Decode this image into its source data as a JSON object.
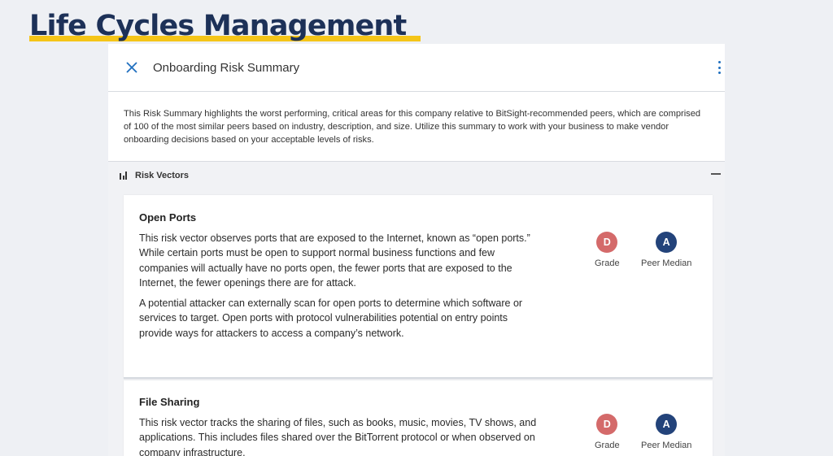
{
  "slide": {
    "title": "Life Cycles Management"
  },
  "panel": {
    "title": "Onboarding Risk Summary",
    "intro": "This Risk Summary highlights the worst performing, critical areas for this company relative to BitSight-recommended peers, which are comprised of 100 of the most similar peers based on industry, description, and size. Utilize this summary to work with your business to make vendor onboarding decisions based on your acceptable levels of risks.",
    "section_label": "Risk Vectors",
    "icons": {
      "close": "close-icon",
      "menu": "kebab-menu-icon",
      "section": "bar-chart-icon",
      "collapse": "minus-icon"
    },
    "colors": {
      "accent": "#1f6fbf",
      "grade_badge": "#d46a6a",
      "peer_badge": "#23437a",
      "title": "#1d3158",
      "title_underline": "#f5c518"
    }
  },
  "cards": [
    {
      "title": "Open Ports",
      "paragraphs": [
        "This risk vector observes ports that are exposed to the Internet, known as “open ports.” While certain ports must be open to support normal business functions and few companies will actually have no ports open, the fewer ports that are exposed to the Internet, the fewer openings there are for attack.",
        "A potential attacker can externally scan for open ports to determine which software or services to target. Open ports with protocol vulnerabilities potential on entry points provide ways for attackers to access a company’s network."
      ],
      "grade": "D",
      "grade_label": "Grade",
      "peer": "A",
      "peer_label": "Peer Median"
    },
    {
      "title": "File Sharing",
      "paragraphs": [
        "This risk vector tracks the sharing of files, such as books, music, movies, TV shows, and applications. This includes files shared over the BitTorrent protocol or when observed on company infrastructure."
      ],
      "grade": "D",
      "grade_label": "Grade",
      "peer": "A",
      "peer_label": "Peer Median"
    }
  ]
}
